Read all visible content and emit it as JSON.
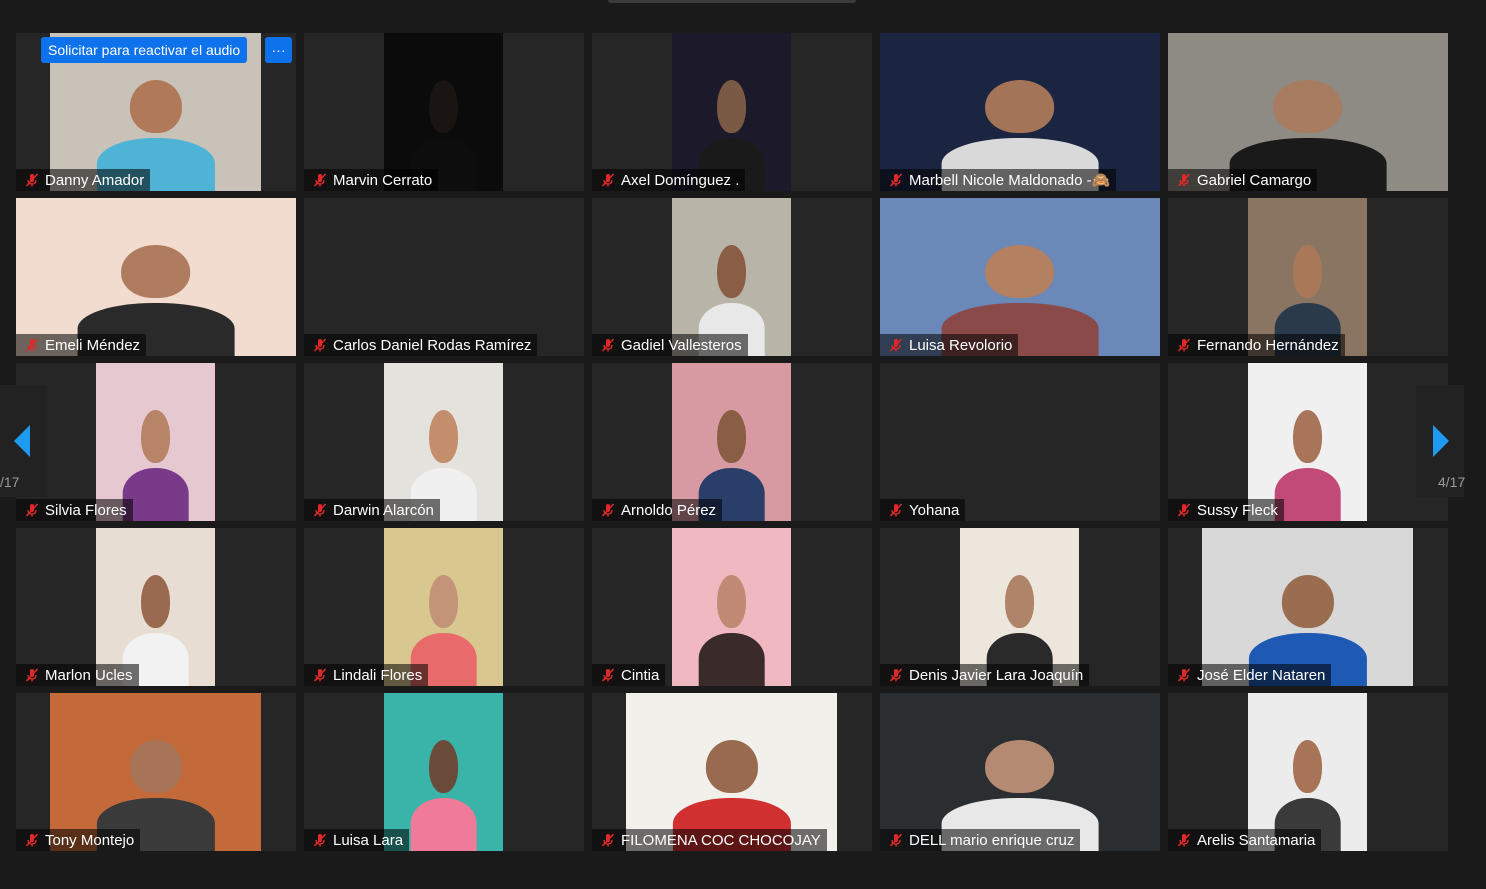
{
  "meeting": {
    "request_unmute_label": "Solicitar para reactivar el audio",
    "more_label": "···",
    "page_left": "/17",
    "page_right": "4/17"
  },
  "colors": {
    "accent": "#0e72ed",
    "muted_icon": "#e02828",
    "tile_bg": "#262626"
  },
  "participants": [
    {
      "name": "Danny Amador",
      "bg": "#c9c2b8",
      "skin": "#b07a5a",
      "shirt": "#4fb3d6",
      "video": "mid"
    },
    {
      "name": "Marvin Cerrato",
      "bg": "#0b0b0b",
      "skin": "#1a1412",
      "shirt": "#0d0d0d",
      "video": "narrow-dark"
    },
    {
      "name": "Axel Domínguez .",
      "bg": "#1c1a2a",
      "skin": "#7a5a44",
      "shirt": "#1a1a1a",
      "video": "narrow"
    },
    {
      "name": "Marbell Nicole Maldonado -🙈",
      "bg": "#1b2440",
      "skin": "#a37458",
      "shirt": "#d9d9d9",
      "video": "wide"
    },
    {
      "name": "Gabriel Camargo",
      "bg": "#8e8a84",
      "skin": "#a87c60",
      "shirt": "#1a1a1a",
      "video": "wide"
    },
    {
      "name": "Emeli Méndez",
      "bg": "#f2dccf",
      "skin": "#b07c60",
      "shirt": "#2a2a2a",
      "video": "wide"
    },
    {
      "name": "Carlos Daniel Rodas Ramírez",
      "bg": "#262626",
      "skin": "#262626",
      "shirt": "#262626",
      "video": "none"
    },
    {
      "name": "Gadiel Vallesteros",
      "bg": "#b9b4a8",
      "skin": "#8a5e44",
      "shirt": "#e8e8e8",
      "video": "narrow"
    },
    {
      "name": "Luisa Revolorio",
      "bg": "#6a88b8",
      "skin": "#b48062",
      "shirt": "#8a4a4a",
      "video": "wide"
    },
    {
      "name": "Fernando Hernández",
      "bg": "#8a7462",
      "skin": "#a87858",
      "shirt": "#2a3a4a",
      "video": "narrow"
    },
    {
      "name": "Silvia Flores",
      "bg": "#e6c8d0",
      "skin": "#b88468",
      "shirt": "#7a3a8a",
      "video": "narrow"
    },
    {
      "name": "Darwin Alarcón",
      "bg": "#e4e2dc",
      "skin": "#c48e6c",
      "shirt": "#f0f0f0",
      "video": "narrow"
    },
    {
      "name": "Arnoldo Pérez",
      "bg": "#d89aa2",
      "skin": "#8a5e44",
      "shirt": "#2a3e6a",
      "video": "narrow"
    },
    {
      "name": "Yohana",
      "bg": "#262626",
      "skin": "#262626",
      "shirt": "#262626",
      "video": "none"
    },
    {
      "name": "Sussy Fleck",
      "bg": "#f0f0f0",
      "skin": "#a8745a",
      "shirt": "#c24a78",
      "video": "narrow"
    },
    {
      "name": "Marlon Ucles",
      "bg": "#e8ddd2",
      "skin": "#9a6a50",
      "shirt": "#f2f2f2",
      "video": "narrow"
    },
    {
      "name": "Lindali Flores",
      "bg": "#d8c890",
      "skin": "#c49478",
      "shirt": "#e86a6a",
      "video": "narrow"
    },
    {
      "name": "Cintia",
      "bg": "#f0b8c0",
      "skin": "#c08a74",
      "shirt": "#3a2a2a",
      "video": "narrow"
    },
    {
      "name": "Denis Javier Lara Joaquín",
      "bg": "#ece6dc",
      "skin": "#b08468",
      "shirt": "#2a2a2a",
      "video": "narrow"
    },
    {
      "name": "José  Elder Nataren",
      "bg": "#d8d8d8",
      "skin": "#9a6c50",
      "shirt": "#1e5ab4",
      "video": "mid"
    },
    {
      "name": "Tony Montejo",
      "bg": "#c46a3a",
      "skin": "#a87458",
      "shirt": "#3a3a3a",
      "video": "mid"
    },
    {
      "name": "Luisa Lara",
      "bg": "#3ab4a8",
      "skin": "#6a4a38",
      "shirt": "#f07a9a",
      "video": "narrow"
    },
    {
      "name": "FILOMENA COC CHOCOJAY",
      "bg": "#f2f0ea",
      "skin": "#9a6a50",
      "shirt": "#d03030",
      "video": "mid"
    },
    {
      "name": "DELL mario enrique cruz",
      "bg": "#2a2e30",
      "skin": "#b48a72",
      "shirt": "#e8e8e8",
      "video": "wide"
    },
    {
      "name": "Arelis Santamaria",
      "bg": "#ececec",
      "skin": "#a87458",
      "shirt": "#3a3a3a",
      "video": "narrow"
    }
  ]
}
